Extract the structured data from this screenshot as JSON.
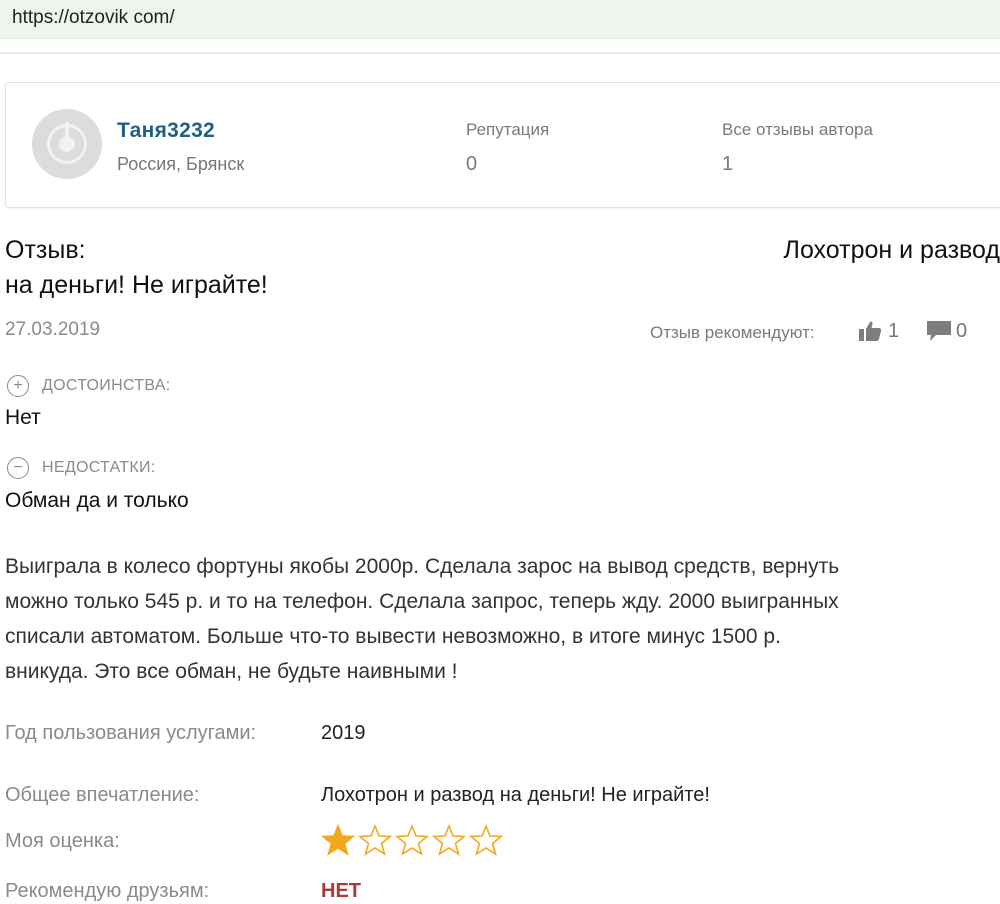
{
  "browser": {
    "url": "https://otzovik com/"
  },
  "author": {
    "name": "Таня3232",
    "location": "Россия, Брянск",
    "reputation_label": "Репутация",
    "reputation_value": "0",
    "reviews_label": "Все отзывы автора",
    "reviews_value": "1"
  },
  "review": {
    "title_prefix": "Отзыв:",
    "title_part1": "Лохотрон и развод",
    "title_part2": "на деньги! Не играйте!",
    "date": "27.03.2019",
    "recommend_label": "Отзыв рекомендуют:",
    "likes": "1",
    "comments": "0",
    "pros_label": "ДОСТОИНСТВА:",
    "pros_icon": "+",
    "pros": "Нет",
    "cons_label": "НЕДОСТАТКИ:",
    "cons_icon": "−",
    "cons": "Обман да и только",
    "body_lines": [
      "Выиграла в колесо фортуны якобы 2000р. Сделала зарос на вывод средств, вернуть",
      "можно только 545 р. и то на телефон. Сделала запрос, теперь жду. 2000 выигранных",
      "списали автоматом. Больше что-то вывести невозможно, в итоге минус 1500 р.",
      "вникуда. Это все обман, не будьте наивными !"
    ]
  },
  "details": {
    "year_label": "Год пользования услугами:",
    "year_value": "2019",
    "impression_label": "Общее впечатление:",
    "impression_value": "Лохотрон и развод на деньги! Не играйте!",
    "rating_label": "Моя оценка:",
    "rating_value": 1,
    "rating_max": 5,
    "recommend_friends_label": "Рекомендую друзьям:",
    "recommend_friends_value": "НЕТ"
  },
  "colors": {
    "author_name": "#1f5f86",
    "star_filled": "#f2a81d",
    "star_empty_outline": "#f2a81d",
    "no_value": "#a93a3a",
    "urlbar_bg": "#eef5ec"
  }
}
